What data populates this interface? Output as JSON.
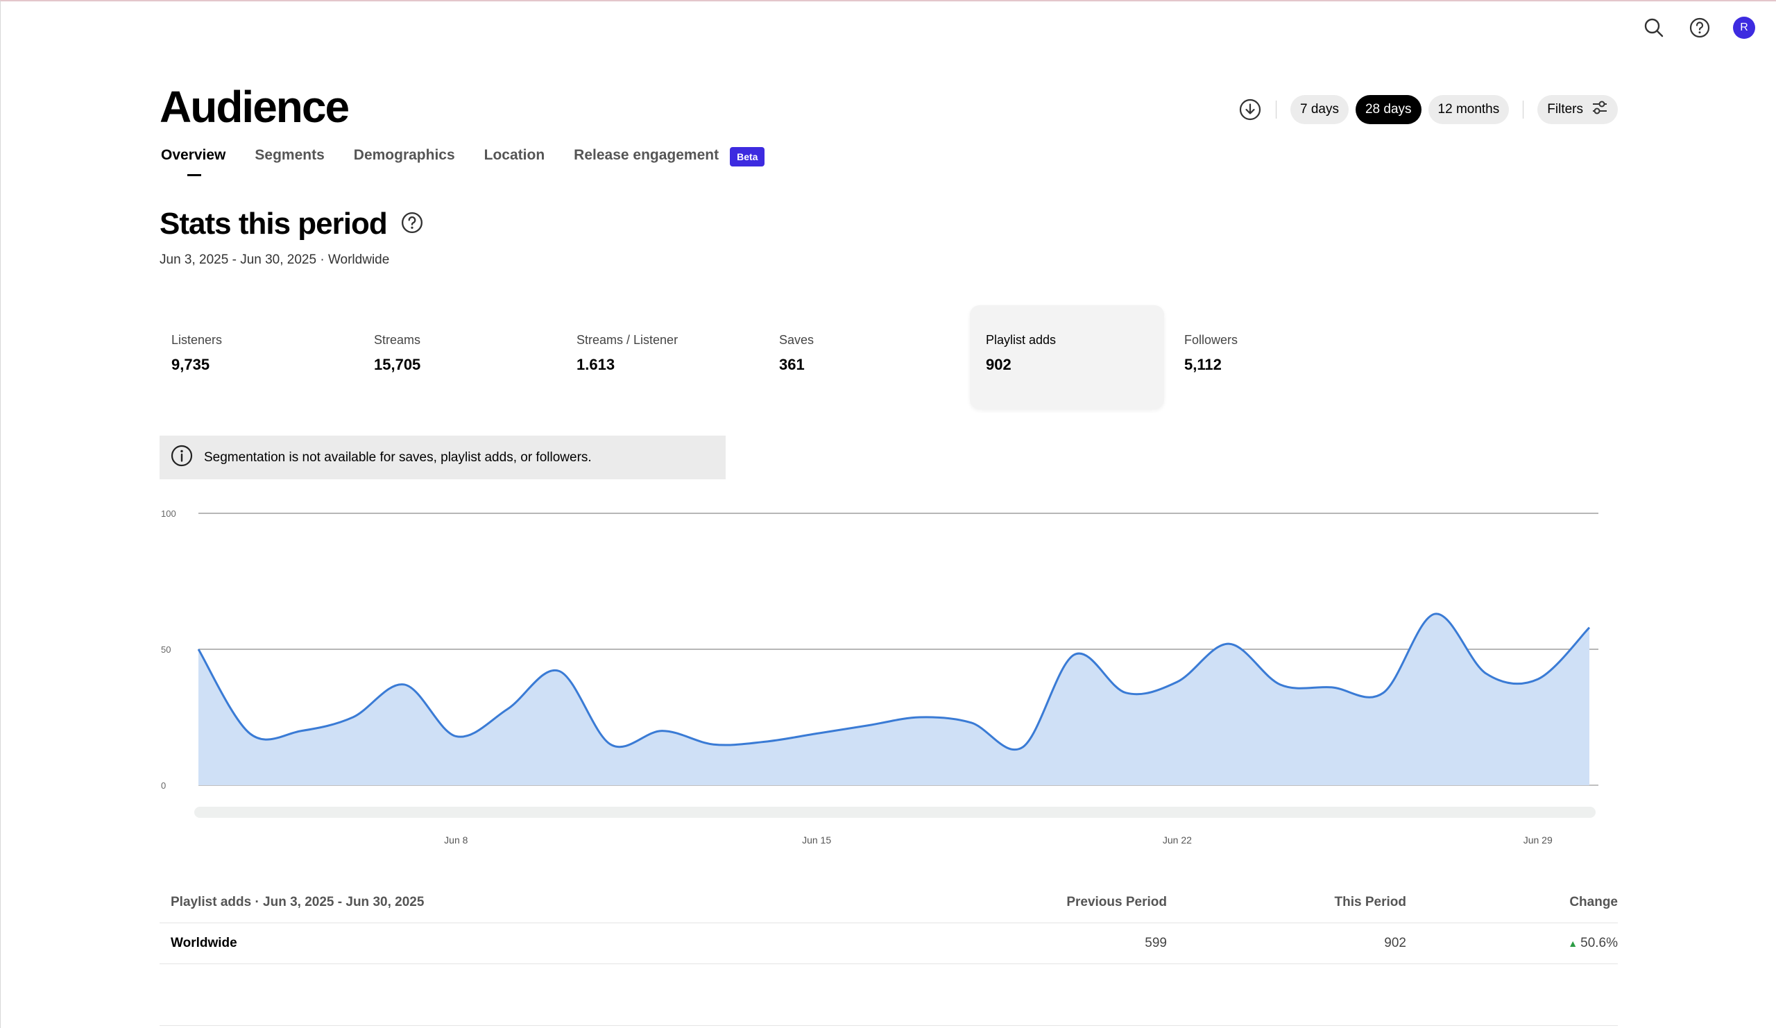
{
  "header": {
    "avatar_initial": "R"
  },
  "page": {
    "title": "Audience"
  },
  "controls": {
    "ranges": [
      "7 days",
      "28 days",
      "12 months"
    ],
    "active_range": "28 days",
    "filters_label": "Filters"
  },
  "tabs": [
    {
      "label": "Overview",
      "active": true
    },
    {
      "label": "Segments"
    },
    {
      "label": "Demographics"
    },
    {
      "label": "Location"
    },
    {
      "label": "Release engagement"
    }
  ],
  "beta_badge": "Beta",
  "stats": {
    "title": "Stats this period",
    "subtitle": "Jun 3, 2025 - Jun 30, 2025 · Worldwide",
    "metrics": [
      {
        "label": "Listeners",
        "value": "9,735"
      },
      {
        "label": "Streams",
        "value": "15,705"
      },
      {
        "label": "Streams / Listener",
        "value": "1.613"
      },
      {
        "label": "Saves",
        "value": "361"
      },
      {
        "label": "Playlist adds",
        "value": "902",
        "selected": true
      },
      {
        "label": "Followers",
        "value": "5,112"
      }
    ]
  },
  "notice": {
    "text": "Segmentation is not available for saves, playlist adds, or followers."
  },
  "chart_data": {
    "type": "area",
    "x": [
      "Jun 3",
      "Jun 4",
      "Jun 5",
      "Jun 6",
      "Jun 7",
      "Jun 8",
      "Jun 9",
      "Jun 10",
      "Jun 11",
      "Jun 12",
      "Jun 13",
      "Jun 14",
      "Jun 15",
      "Jun 16",
      "Jun 17",
      "Jun 18",
      "Jun 19",
      "Jun 20",
      "Jun 21",
      "Jun 22",
      "Jun 23",
      "Jun 24",
      "Jun 25",
      "Jun 26",
      "Jun 27",
      "Jun 28",
      "Jun 29",
      "Jun 30"
    ],
    "values": [
      50,
      19,
      20,
      25,
      37,
      18,
      28,
      42,
      15,
      20,
      15,
      16,
      19,
      22,
      25,
      23,
      14,
      48,
      34,
      38,
      52,
      37,
      36,
      34,
      63,
      41,
      39,
      58
    ],
    "ylim": [
      0,
      100
    ],
    "yticks": [
      0,
      50,
      100
    ],
    "xticks": [
      "Jun 8",
      "Jun 15",
      "Jun 22",
      "Jun 29"
    ],
    "color": "#3a7bd5",
    "fill": "#cfe0f6"
  },
  "table": {
    "headers": [
      "Playlist adds · Jun 3, 2025 - Jun 30, 2025",
      "Previous Period",
      "This Period",
      "Change"
    ],
    "rows": [
      {
        "region": "Worldwide",
        "previous": "599",
        "current": "902",
        "change": "50.6%"
      }
    ]
  }
}
